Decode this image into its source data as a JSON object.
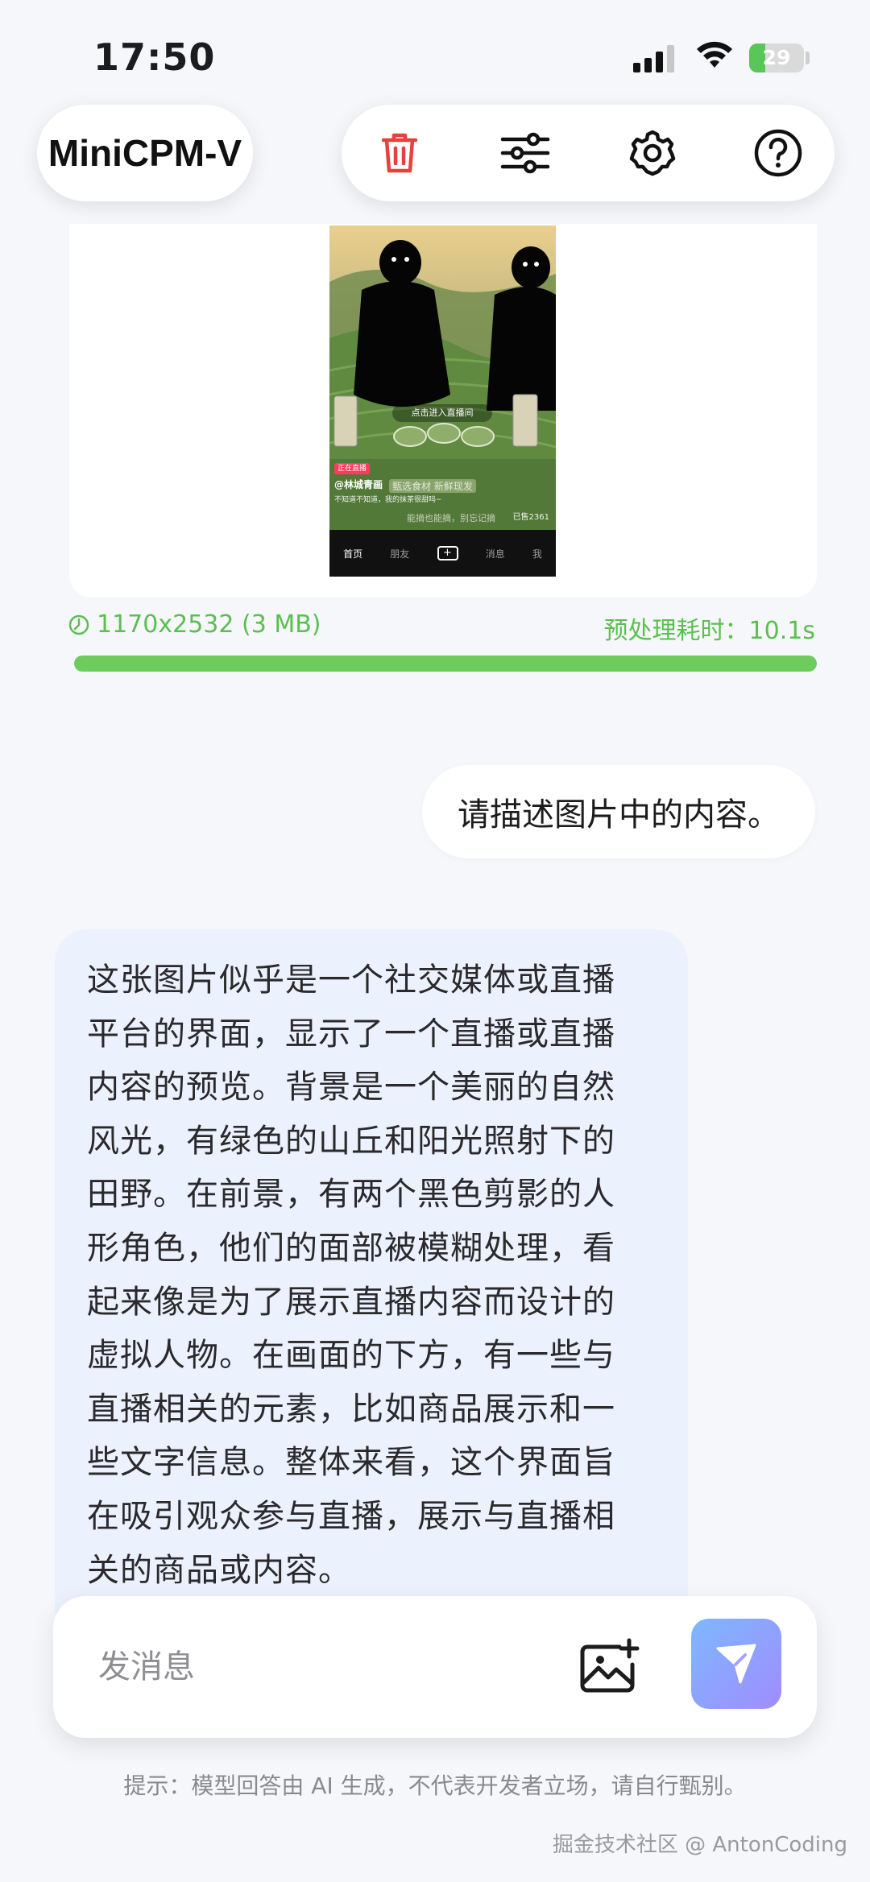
{
  "status_bar": {
    "time": "17:50",
    "battery": "29"
  },
  "header": {
    "title": "MiniCPM-V",
    "tools": [
      "trash-icon",
      "sliders-icon",
      "gear-icon",
      "help-icon"
    ]
  },
  "attachment": {
    "preview": {
      "live_bubble": "点击进入直播间",
      "tag": "正在直播",
      "handle": "@林城青画",
      "subtitle": "不知道不知道，我的抹茶很甜吗~",
      "overlay": "甄选食材 新鲜现发",
      "overlay2": "能摘也能摘，别忘记摘",
      "count": "已售2361",
      "tabs": [
        "首页",
        "朋友",
        "+",
        "消息",
        "我"
      ]
    },
    "size_label": "1170x2532 (3 MB)",
    "preprocess_label": "预处理耗时：10.1s",
    "progress": 1.0,
    "accent_color": "#5bbf50"
  },
  "messages": {
    "user": "请描述图片中的内容。",
    "assistant_lines": [
      "这张图片似乎是一个社交媒体或直播",
      "平台的界面，显示了一个直播或直播",
      "内容的预览。背景是一个美丽的自然",
      "风光，有绿色的山丘和阳光照射下的",
      "田野。在前景，有两个黑色剪影的人",
      "形角色，他们的面部被模糊处理，看",
      "起来像是为了展示直播内容而设计的",
      "虚拟人物。在画面的下方，有一些与",
      "直播相关的元素，比如商品展示和一",
      "些文字信息。整体来看，这个界面旨",
      "在吸引观众参与直播，展示与直播相",
      "关的商品或内容。"
    ]
  },
  "composer": {
    "placeholder": "发消息",
    "image_button_icon": "add-image-icon",
    "send_button_icon": "send-icon"
  },
  "footer": {
    "disclaimer": "提示：模型回答由 AI 生成，不代表开发者立场，请自行甄别。",
    "watermark": "掘金技术社区 @ AntonCoding"
  }
}
